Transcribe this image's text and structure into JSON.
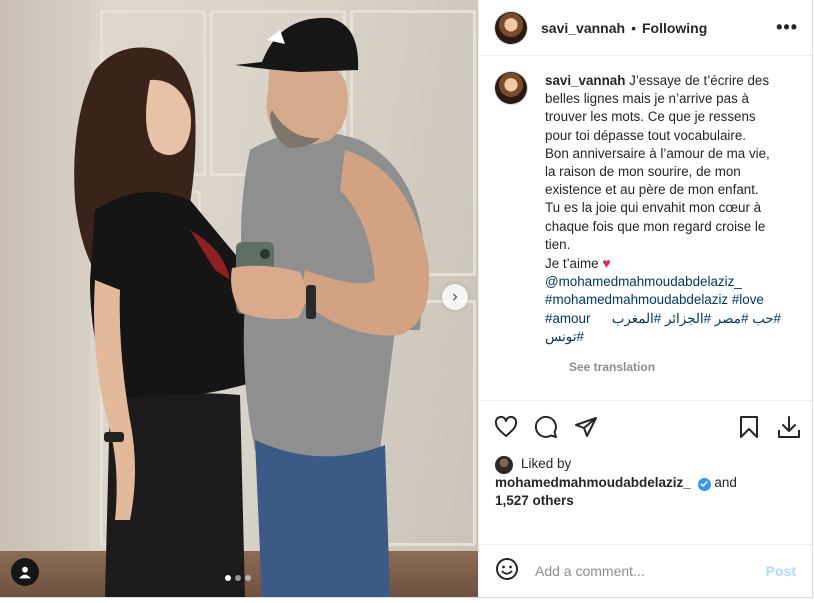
{
  "post": {
    "username": "savi_vannah",
    "follow_status": "Following",
    "more_icon": "•••",
    "caption": {
      "username": "savi_vannah",
      "lines": [
        "J’essaye de t’écrire des",
        "belles lignes mais je n’arrive pas à",
        "trouver les mots. Ce que je ressens",
        "pour toi dépasse tout vocabulaire.",
        "Bon anniversaire à l’amour de ma vie,",
        "la raison de mon sourire, de mon",
        "existence et au père de mon enfant.",
        "Tu es la joie qui envahit mon cœur à",
        "chaque fois que mon regard croise le",
        "tien."
      ],
      "je_taime": "Je t’aime",
      "mention": "@mohamedmahmoudabdelaziz_",
      "hashtags_line1": "#mohamedmahmoudabdelaziz #love",
      "hashtags_line2_ltr": "#amour",
      "hashtags_line2_rtl": "#حب #مصر #الجزائر #المغرب",
      "hashtags_line3": "#تونس"
    },
    "see_translation": "See translation",
    "likes": {
      "prefix": "Liked by",
      "user": "mohamedmahmoudabdelaziz_",
      "and": "and",
      "others": "1,527 others"
    },
    "comment": {
      "placeholder": "Add a comment...",
      "post_label": "Post"
    }
  },
  "media": {
    "carousel_dots": 3,
    "active_dot": 1,
    "next_arrow": "›"
  },
  "colors": {
    "text": "#262626",
    "secondary": "#8e8e8e",
    "link": "#00376b",
    "post_disabled": "#b3dbff",
    "verified": "#3897f0",
    "heart": "#e0245e"
  }
}
